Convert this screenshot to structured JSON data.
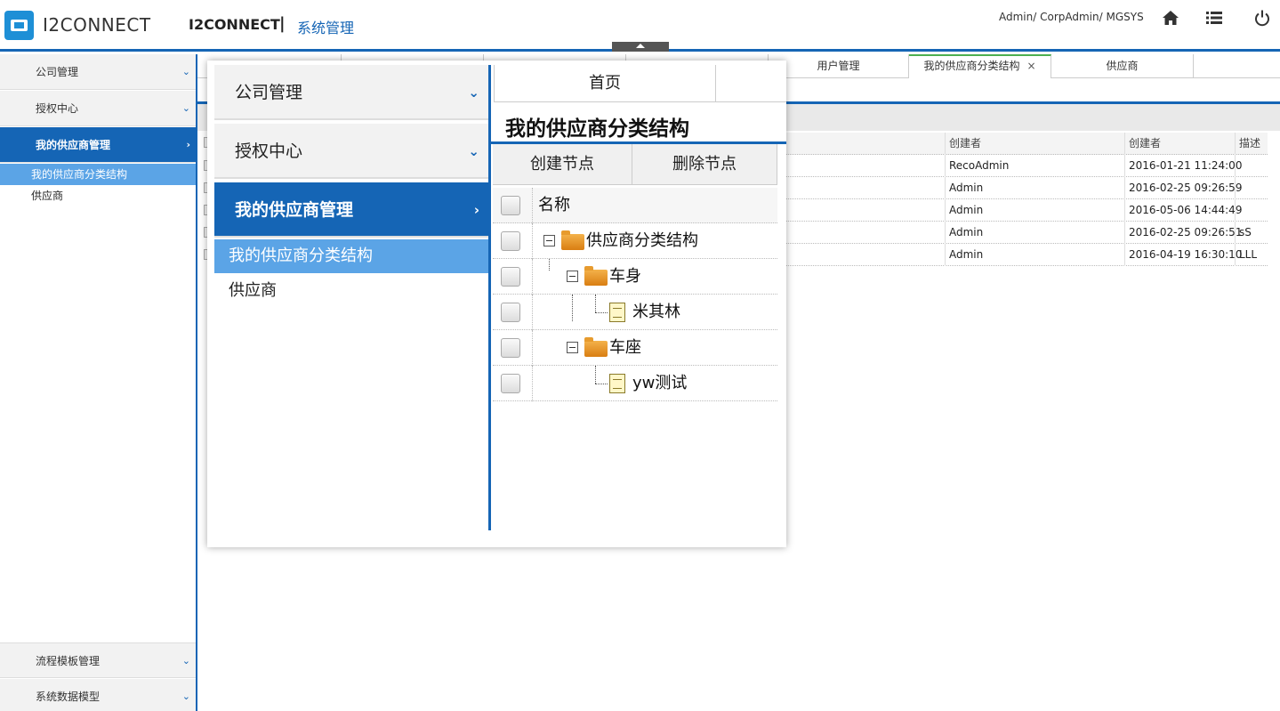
{
  "header": {
    "logo_text": "I2CONNECT",
    "app_name": "I2CONNECT",
    "separator": "|",
    "section": "系统管理",
    "user": "Admin/ CorpAdmin/ MGSYS",
    "icons": [
      "home-icon",
      "list-icon",
      "power-icon"
    ]
  },
  "sidebar": {
    "items": [
      {
        "label": "公司管理"
      },
      {
        "label": "授权中心"
      },
      {
        "label": "我的供应商管理"
      },
      {
        "label": "流程模板管理"
      },
      {
        "label": "系统数据模型"
      }
    ],
    "sub_items": [
      {
        "label": "我的供应商分类结构"
      },
      {
        "label": "供应商"
      }
    ]
  },
  "tabs": [
    {
      "label": "用户管理"
    },
    {
      "label": "我的供应商分类结构",
      "close": "×"
    },
    {
      "label": "供应商"
    }
  ],
  "table": {
    "headers": [
      "创建者",
      "创建者",
      "描述"
    ],
    "rows": [
      {
        "creator": "RecoAdmin",
        "date": "2016-01-21 11:24:00",
        "desc": ""
      },
      {
        "creator": "Admin",
        "date": "2016-02-25 09:26:59",
        "desc": ""
      },
      {
        "creator": "Admin",
        "date": "2016-05-06 14:44:49",
        "desc": ""
      },
      {
        "creator": "Admin",
        "date": "2016-02-25 09:26:51",
        "desc": "sS"
      },
      {
        "creator": "Admin",
        "date": "2016-04-19 16:30:10",
        "desc": "LLL"
      }
    ]
  },
  "zoom": {
    "sidebar": {
      "items": [
        {
          "label": "公司管理"
        },
        {
          "label": "授权中心"
        },
        {
          "label": "我的供应商管理"
        }
      ],
      "sub_items": [
        {
          "label": "我的供应商分类结构"
        },
        {
          "label": "供应商"
        }
      ]
    },
    "home_tab": "首页",
    "page_title": "我的供应商分类结构",
    "toolbar": {
      "create": "创建节点",
      "delete": "删除节点"
    },
    "tree": {
      "column": "名称",
      "nodes": [
        {
          "label": "供应商分类结构",
          "type": "folder"
        },
        {
          "label": "车身",
          "type": "folder"
        },
        {
          "label": "米其林",
          "type": "file"
        },
        {
          "label": "车座",
          "type": "folder"
        },
        {
          "label": "yw测试",
          "type": "file"
        }
      ]
    }
  },
  "colors": {
    "accent": "#1565b5",
    "sub_active": "#5ba4e6",
    "tab_active": "#4caf50"
  }
}
